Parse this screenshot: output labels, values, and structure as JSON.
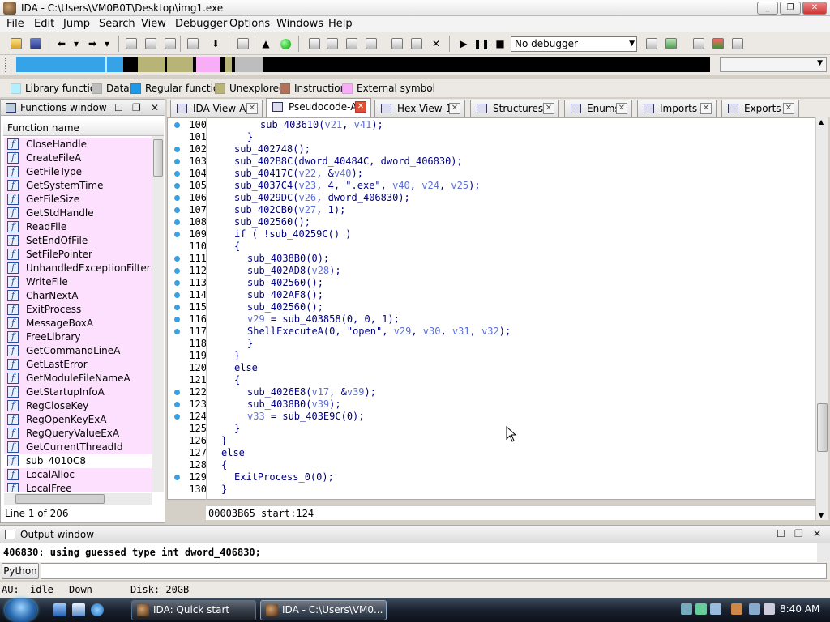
{
  "window": {
    "title": "IDA - C:\\Users\\VM0B0T\\Desktop\\img1.exe"
  },
  "menu": [
    "File",
    "Edit",
    "Jump",
    "Search",
    "View",
    "Debugger",
    "Options",
    "Windows",
    "Help"
  ],
  "toolbar": {
    "debugger_select": "No debugger"
  },
  "nav_band": {
    "segments": [
      {
        "color": "#36a3e8",
        "w": 110
      },
      {
        "color": "#b3f0ff",
        "w": 2
      },
      {
        "color": "#36a3e8",
        "w": 20
      },
      {
        "color": "#000000",
        "w": 18
      },
      {
        "color": "#b8b478",
        "w": 34
      },
      {
        "color": "#000000",
        "w": 2
      },
      {
        "color": "#b8b478",
        "w": 32
      },
      {
        "color": "#000000",
        "w": 4
      },
      {
        "color": "#f7aef7",
        "w": 30
      },
      {
        "color": "#000000",
        "w": 6
      },
      {
        "color": "#b8b478",
        "w": 8
      },
      {
        "color": "#000000",
        "w": 4
      },
      {
        "color": "#bdbdbd",
        "w": 34
      },
      {
        "color": "#000000",
        "w": 552
      }
    ]
  },
  "legend": [
    {
      "label": "Library function",
      "color": "#b3f0ff"
    },
    {
      "label": "Data",
      "color": "#bdbdbd"
    },
    {
      "label": "Regular function",
      "color": "#1e9ae8"
    },
    {
      "label": "Unexplored",
      "color": "#b8b478"
    },
    {
      "label": "Instruction",
      "color": "#b0725a"
    },
    {
      "label": "External symbol",
      "color": "#f7aef7"
    }
  ],
  "functions_window": {
    "title": "Functions window",
    "column": "Function name",
    "items": [
      "CloseHandle",
      "CreateFileA",
      "GetFileType",
      "GetSystemTime",
      "GetFileSize",
      "GetStdHandle",
      "ReadFile",
      "SetEndOfFile",
      "SetFilePointer",
      "UnhandledExceptionFilter",
      "WriteFile",
      "CharNextA",
      "ExitProcess",
      "MessageBoxA",
      "FreeLibrary",
      "GetCommandLineA",
      "GetLastError",
      "GetModuleFileNameA",
      "GetStartupInfoA",
      "RegCloseKey",
      "RegOpenKeyExA",
      "RegQueryValueExA",
      "GetCurrentThreadId",
      "sub_4010C8",
      "LocalAlloc",
      "LocalFree"
    ],
    "status": "Line 1 of 206"
  },
  "tabs": [
    {
      "label": "IDA View-A",
      "active": false
    },
    {
      "label": "Pseudocode-A",
      "active": true
    },
    {
      "label": "Hex View-1",
      "active": false
    },
    {
      "label": "Structures",
      "active": false
    },
    {
      "label": "Enums",
      "active": false
    },
    {
      "label": "Imports",
      "active": false
    },
    {
      "label": "Exports",
      "active": false
    }
  ],
  "code": [
    {
      "n": "100",
      "dot": true,
      "text": "    sub_403610(v21, v41);"
    },
    {
      "n": "101",
      "dot": false,
      "text": "  }"
    },
    {
      "n": "102",
      "dot": true,
      "text": "  sub_402748();"
    },
    {
      "n": "103",
      "dot": true,
      "text": "  sub_402B8C(dword_40484C, dword_406830);"
    },
    {
      "n": "104",
      "dot": true,
      "text": "  sub_40417C(v22, &v40);"
    },
    {
      "n": "105",
      "dot": true,
      "text": "  sub_4037C4(v23, 4, \".exe\", v40, v24, v25);"
    },
    {
      "n": "106",
      "dot": true,
      "text": "  sub_4029DC(v26, dword_406830);"
    },
    {
      "n": "107",
      "dot": true,
      "text": "  sub_402CB0(v27, 1);"
    },
    {
      "n": "108",
      "dot": true,
      "text": "  sub_402560();"
    },
    {
      "n": "109",
      "dot": true,
      "text": "  if ( !sub_40259C() )"
    },
    {
      "n": "110",
      "dot": false,
      "text": "  {"
    },
    {
      "n": "111",
      "dot": true,
      "text": "    sub_4038B0(0);"
    },
    {
      "n": "112",
      "dot": true,
      "text": "    sub_402AD8(v28);"
    },
    {
      "n": "113",
      "dot": true,
      "text": "    sub_402560();"
    },
    {
      "n": "114",
      "dot": true,
      "text": "    sub_402AF8();"
    },
    {
      "n": "115",
      "dot": true,
      "text": "    sub_402560();"
    },
    {
      "n": "116",
      "dot": true,
      "text": "    v29 = sub_403858(0, 0, 1);"
    },
    {
      "n": "117",
      "dot": true,
      "text": "    ShellExecuteA(0, \"open\", v29, v30, v31, v32);"
    },
    {
      "n": "118",
      "dot": false,
      "text": "  }"
    },
    {
      "n": "119",
      "dot": false,
      "text": "}"
    },
    {
      "n": "120",
      "dot": false,
      "text": "else"
    },
    {
      "n": "121",
      "dot": false,
      "text": "{"
    },
    {
      "n": "122",
      "dot": true,
      "text": "  sub_4026E8(v17, &v39);"
    },
    {
      "n": "123",
      "dot": true,
      "text": "  sub_4038B0(v39);"
    },
    {
      "n": "124",
      "dot": true,
      "text": "  v33 = sub_403E9C(0);"
    },
    {
      "n": "125",
      "dot": false,
      "text": "}"
    },
    {
      "n": "126",
      "dot": false,
      "text": "}"
    },
    {
      "n": "127",
      "dot": false,
      "text": "else"
    },
    {
      "n": "128",
      "dot": false,
      "text": "{"
    },
    {
      "n": "129",
      "dot": true,
      "text": "  ExitProcess_0(0);"
    },
    {
      "n": "130",
      "dot": false,
      "text": "}"
    }
  ],
  "code_indent": [
    4,
    3,
    2,
    2,
    2,
    2,
    2,
    2,
    2,
    2,
    2,
    3,
    3,
    3,
    3,
    3,
    3,
    3,
    3,
    2,
    2,
    2,
    3,
    3,
    3,
    2,
    1,
    1,
    1,
    2,
    1
  ],
  "address_bar": "00003B65 start:124",
  "output_window": {
    "title": "Output window",
    "line": "406830: using guessed type int dword_406830;",
    "python_btn": "Python"
  },
  "status": {
    "au": "AU:",
    "state": "idle",
    "dir": "Down",
    "disk": "Disk: 20GB"
  },
  "taskbar": {
    "tasks": [
      {
        "label": "IDA: Quick start",
        "active": false
      },
      {
        "label": "IDA - C:\\Users\\VM0...",
        "active": true
      }
    ],
    "clock": "8:40 AM"
  }
}
